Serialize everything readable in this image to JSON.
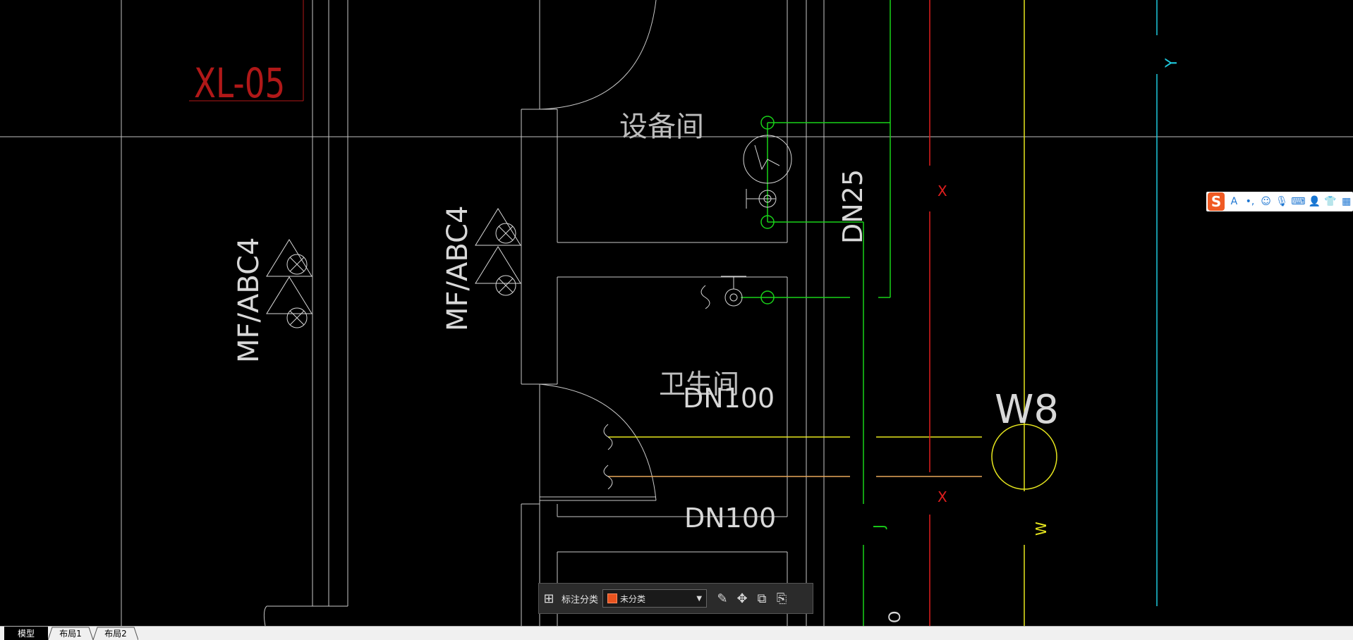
{
  "drawing": {
    "sheet_label": "XL-05",
    "extinguisher_label_left": "MF/ABC4",
    "extinguisher_label_mid": "MF/ABC4",
    "room_equipment": "设备间",
    "room_toilet": "卫生间",
    "pipe_dn25": "DN25",
    "pipe_dn100_top": "DN100",
    "pipe_dn100_bottom": "DN100",
    "drain_riser": "W8",
    "axis_marker": "Y",
    "line_marker_x1": "X",
    "line_marker_x2": "X",
    "line_marker_j": "J",
    "line_marker_w": "W",
    "line_marker_o": "O",
    "colors": {
      "background": "#000000",
      "wall": "#c8c8c8",
      "supply_pipe": "#19d219",
      "fire_pipe": "#e01e1e",
      "drain_pipe": "#e6e61e",
      "axis": "#1ec8dc",
      "sheet_label": "#b01818"
    }
  },
  "ime_toolbar": {
    "logo": "S",
    "icons": [
      "font-icon",
      "punctuation-icon",
      "emoji-icon",
      "microphone-icon",
      "keyboard-icon",
      "user-icon",
      "skin-icon",
      "grid-icon"
    ]
  },
  "annotation_toolbar": {
    "category_label": "标注分类",
    "category_value": "未分类",
    "category_color": "#e8531f",
    "icons": [
      "apps-icon",
      "edit-icon",
      "move-icon",
      "copy-icon",
      "paste-icon"
    ]
  },
  "tabs": [
    "模型",
    "布局1",
    "布局2"
  ],
  "active_tab": "模型"
}
